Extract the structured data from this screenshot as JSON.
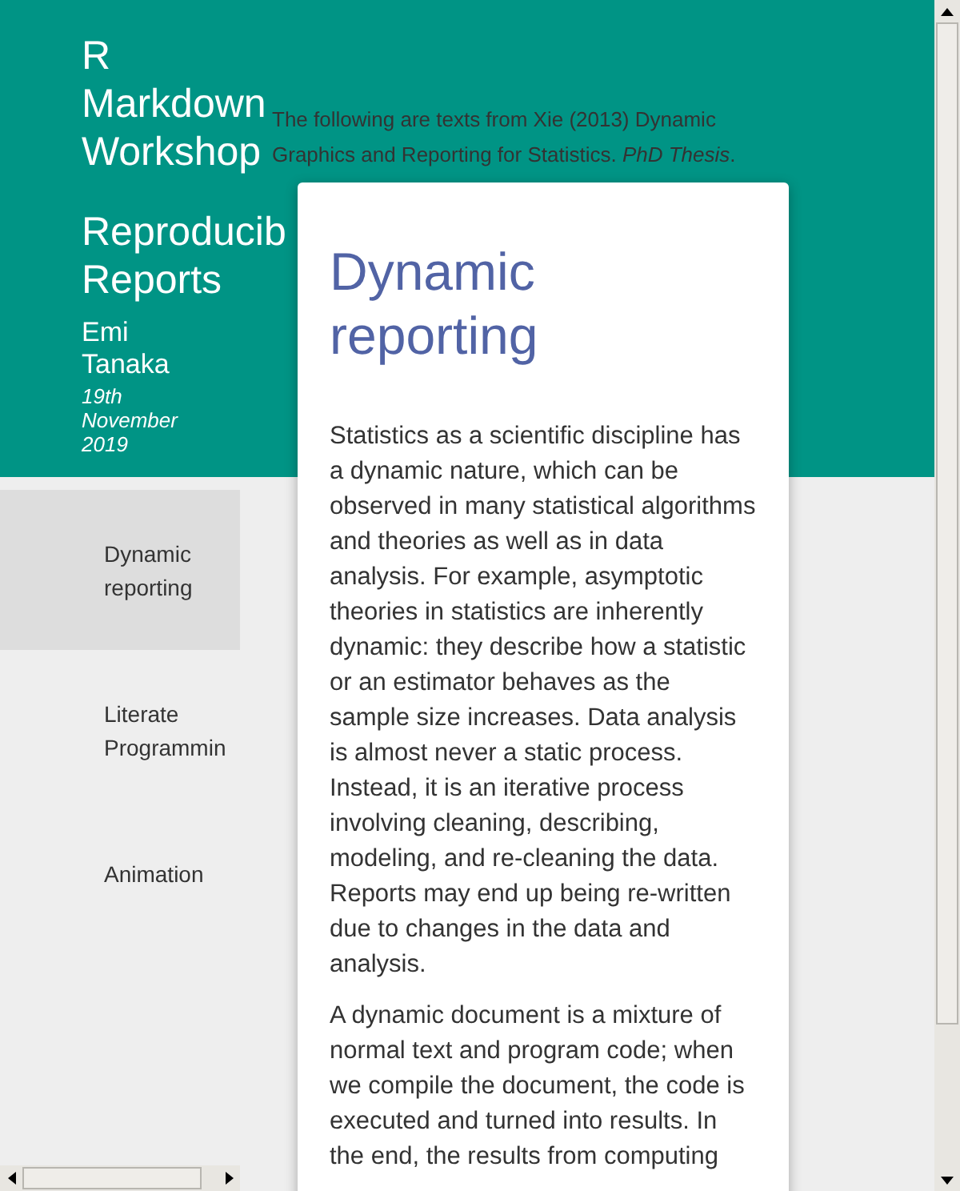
{
  "header": {
    "title": "R Markdown Workshop",
    "subtitle": "Reproducib Reports",
    "author": "Emi Tanaka",
    "date": "19th November 2019"
  },
  "intro": "The following are texts from Xie (2013) Dynamic Graphics and Reporting for Statistics. *PhD Thesis*.",
  "sidebar": {
    "items": [
      {
        "label": "Dynamic reporting",
        "selected": true
      },
      {
        "label": "Literate Programmin",
        "selected": false
      },
      {
        "label": "Animation",
        "selected": false
      }
    ]
  },
  "card": {
    "heading": "Dynamic reporting",
    "paragraphs": [
      "Statistics as a scientific discipline has a dynamic nature, which can be observed in many statistical algorithms and theories as well as in data analysis. For example, asymptotic theories in statistics are inherently dynamic: they describe how a statistic or an estimator behaves as the sample size increases. Data analysis is almost never a static process. Instead, it is an iterative process involving cleaning, describing, modeling, and re-cleaning the data. Reports may end up being re-written due to changes in the data and analysis.",
      "A dynamic document is a mixture of normal text and program code; when we compile the document, the code is executed and turned into results. In the end, the results from computing"
    ]
  }
}
